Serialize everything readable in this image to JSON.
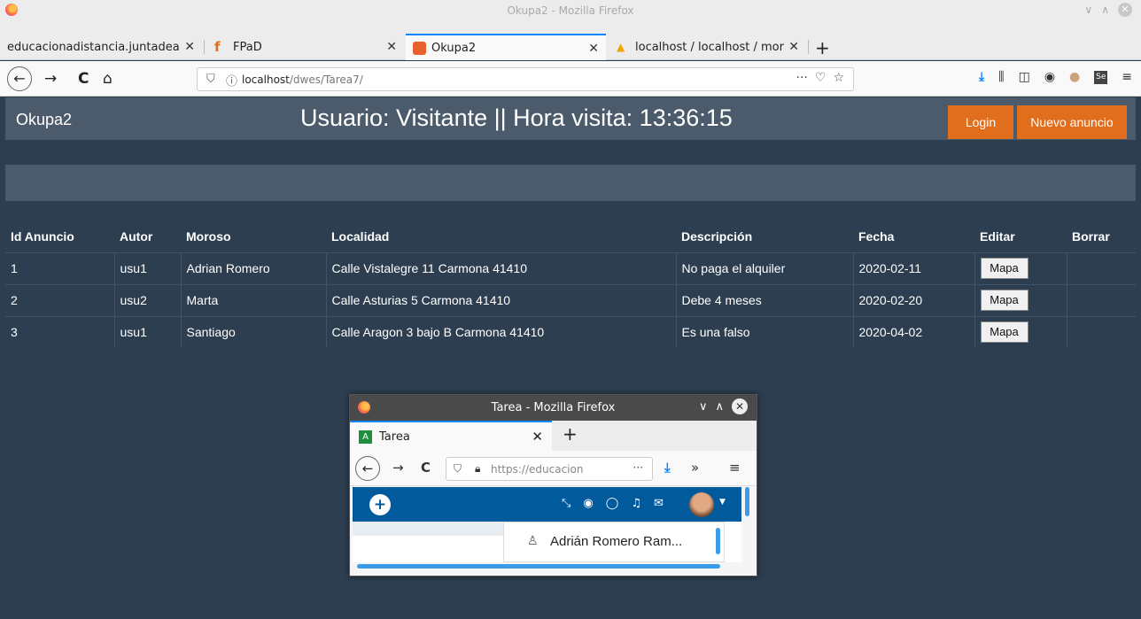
{
  "window": {
    "title": "Okupa2 - Mozilla Firefox"
  },
  "tabs": [
    {
      "label": "educacionadistancia.juntadea",
      "close": "✕"
    },
    {
      "label": "FPaD",
      "close": "✕"
    },
    {
      "label": "Okupa2",
      "close": "✕"
    },
    {
      "label": "localhost / localhost / mor",
      "close": "✕"
    }
  ],
  "new_tab": "+",
  "navbar": {
    "back": "←",
    "forward": "→",
    "reload": "C",
    "home": "⌂",
    "url_host": "localhost",
    "url_path": "/dwes/Tarea7/",
    "page_actions": "···",
    "pocket": "♡",
    "bookmark": "☆",
    "menu": "≡"
  },
  "page": {
    "brand": "Okupa2",
    "headline": "Usuario: Visitante || Hora visita: 13:36:15",
    "login_label": "Login",
    "new_ad_label": "Nuevo anuncio"
  },
  "table": {
    "headers": [
      "Id Anuncio",
      "Autor",
      "Moroso",
      "Localidad",
      "Descripción",
      "Fecha",
      "Editar",
      "Borrar"
    ],
    "rows": [
      {
        "id": "1",
        "autor": "usu1",
        "moroso": "Adrian Romero",
        "localidad": "Calle Vistalegre 11 Carmona 41410",
        "descripcion": "No paga el alquiler",
        "fecha": "2020-02-11",
        "editar": "Mapa"
      },
      {
        "id": "2",
        "autor": "usu2",
        "moroso": "Marta",
        "localidad": "Calle Asturias 5 Carmona 41410",
        "descripcion": "Debe 4 meses",
        "fecha": "2020-02-20",
        "editar": "Mapa"
      },
      {
        "id": "3",
        "autor": "usu1",
        "moroso": "Santiago",
        "localidad": "Calle Aragon 3 bajo B Carmona 41410",
        "descripcion": "Es una falso",
        "fecha": "2020-04-02",
        "editar": "Mapa"
      }
    ]
  },
  "popup": {
    "title": "Tarea - Mozilla Firefox",
    "tab_label": "Tarea",
    "tab_close": "✕",
    "new_tab": "+",
    "url": "https://educacion",
    "page_actions": "···",
    "overflow": "»",
    "menu": "≡",
    "user_name": "Adrián Romero Ram..."
  },
  "colors": {
    "page_bg": "#2c3e50",
    "header_bg": "#4b5b6b",
    "accent_orange": "#e06e1c",
    "firefox_blue": "#0a84ff",
    "moodle_blue": "#005a9c"
  },
  "icons": [
    "firefox-logo",
    "back-arrow",
    "forward-arrow",
    "reload",
    "home",
    "shield",
    "info",
    "download",
    "library",
    "sidebar",
    "account",
    "extension",
    "menu",
    "lock",
    "bell",
    "envelope",
    "chat",
    "globe",
    "compress"
  ]
}
